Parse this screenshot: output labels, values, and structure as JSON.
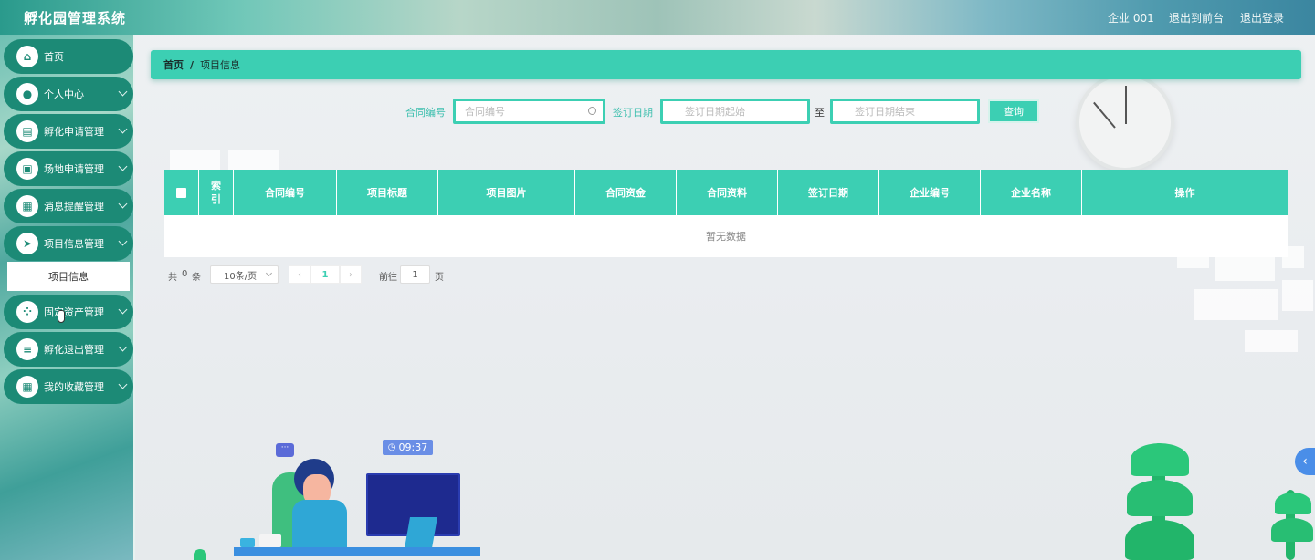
{
  "header": {
    "title": "孵化园管理系统",
    "user": "企业 001",
    "front": "退出到前台",
    "logout": "退出登录"
  },
  "sidebar": {
    "items": [
      {
        "label": "首页",
        "icon": "home-icon"
      },
      {
        "label": "个人中心",
        "icon": "user-icon"
      },
      {
        "label": "孵化申请管理",
        "icon": "clipboard-icon"
      },
      {
        "label": "场地申请管理",
        "icon": "briefcase-icon"
      },
      {
        "label": "消息提醒管理",
        "icon": "grid-icon"
      },
      {
        "label": "项目信息管理",
        "icon": "send-icon"
      },
      {
        "label": "固定资产管理",
        "icon": "apps-icon"
      },
      {
        "label": "孵化退出管理",
        "icon": "sliders-icon"
      },
      {
        "label": "我的收藏管理",
        "icon": "grid-icon"
      }
    ],
    "sub_item": "项目信息"
  },
  "breadcrumb": {
    "home": "首页",
    "sep": "/",
    "current": "项目信息"
  },
  "search": {
    "contract_label": "合同编号",
    "contract_placeholder": "合同编号",
    "date_label": "签订日期",
    "date_start_placeholder": "签订日期起始",
    "to": "至",
    "date_end_placeholder": "签订日期结束",
    "query": "查询"
  },
  "table": {
    "columns": [
      "索引",
      "合同编号",
      "项目标题",
      "项目图片",
      "合同资金",
      "合同资料",
      "签订日期",
      "企业编号",
      "企业名称",
      "操作"
    ],
    "index_col": "索\n引",
    "empty": "暂无数据"
  },
  "pagination": {
    "total_prefix": "共",
    "total": "0",
    "total_suffix": "条",
    "page_size": "10条/页",
    "current_page": "1",
    "goto": "前往",
    "goto_value": "1",
    "page_unit": "页"
  },
  "illustration": {
    "time": "09:37"
  }
}
